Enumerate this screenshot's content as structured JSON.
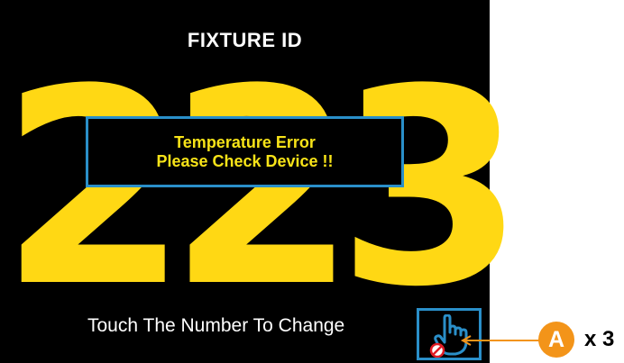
{
  "screen": {
    "title": "FIXTURE ID",
    "fixture_number": "223",
    "error": {
      "line1": "Temperature Error",
      "line2": "Please Check Device !!"
    },
    "hint": "Touch The Number To Change",
    "lock_button": {
      "icon": "hand-touch-lock-icon"
    }
  },
  "annotation": {
    "badge_label": "A",
    "count_label": "x 3"
  },
  "colors": {
    "screen_bg": "#000000",
    "number": "#ffd814",
    "error_text": "#f7e318",
    "accent_border": "#2a8fc9",
    "callout": "#f39419"
  }
}
